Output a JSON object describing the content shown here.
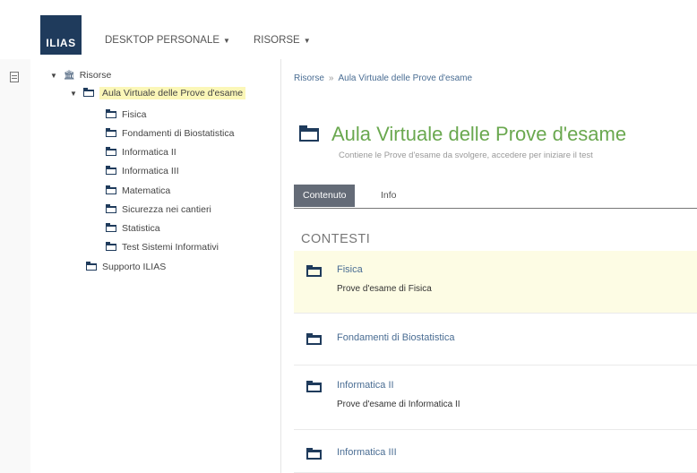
{
  "header": {
    "logo_text": "ILIAS",
    "menu": [
      {
        "label": "DESKTOP PERSONALE"
      },
      {
        "label": "RISORSE"
      }
    ]
  },
  "tree": {
    "root": "Risorse",
    "current": "Aula Virtuale delle Prove d'esame",
    "children": [
      "Fisica",
      "Fondamenti di Biostatistica",
      "Informatica II",
      "Informatica III",
      "Matematica",
      "Sicurezza nei cantieri",
      "Statistica",
      "Test Sistemi Informativi"
    ],
    "sibling": "Supporto ILIAS"
  },
  "breadcrumb": [
    "Risorse",
    "Aula Virtuale delle Prove d'esame"
  ],
  "page": {
    "title": "Aula Virtuale delle Prove d'esame",
    "description": "Contiene le Prove d'esame da svolgere, accedere per iniziare il test"
  },
  "tabs": [
    {
      "label": "Contenuto",
      "active": true
    },
    {
      "label": "Info",
      "active": false
    }
  ],
  "section_title": "CONTESTI",
  "items": [
    {
      "name": "Fisica",
      "description": "Prove d'esame di Fisica"
    },
    {
      "name": "Fondamenti di Biostatistica",
      "description": ""
    },
    {
      "name": "Informatica II",
      "description": "Prove d'esame di Informatica II"
    },
    {
      "name": "Informatica III",
      "description": ""
    }
  ],
  "colors": {
    "brand": "#1f3b5c",
    "title_green": "#6aa84f",
    "link_blue": "#4a6d93",
    "highlight": "#fbf7b8"
  }
}
